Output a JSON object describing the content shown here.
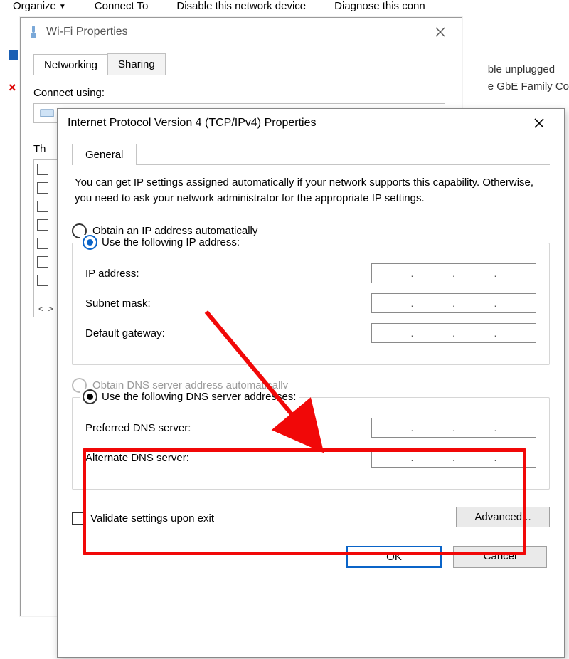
{
  "bg_toolbar": {
    "organize": "Organize",
    "connect": "Connect To",
    "disable": "Disable this network device",
    "diagnose": "Diagnose this conn"
  },
  "bg_right": {
    "line1": "ble unplugged",
    "line2": "e GbE Family Co"
  },
  "wifi": {
    "title": "Wi-Fi Properties",
    "tab_networking": "Networking",
    "tab_sharing": "Sharing",
    "connect_using": "Connect using:",
    "items_label": "Th"
  },
  "ipv4": {
    "title": "Internet Protocol Version 4 (TCP/IPv4) Properties",
    "tab_general": "General",
    "intro": "You can get IP settings assigned automatically if your network supports this capability. Otherwise, you need to ask your network administrator for the appropriate IP settings.",
    "obtain_ip_auto": "Obtain an IP address automatically",
    "use_ip": "Use the following IP address:",
    "ip_address": "IP address:",
    "subnet": "Subnet mask:",
    "gateway": "Default gateway:",
    "obtain_dns_auto": "Obtain DNS server address automatically",
    "use_dns": "Use the following DNS server addresses:",
    "pref_dns": "Preferred DNS server:",
    "alt_dns": "Alternate DNS server:",
    "validate": "Validate settings upon exit",
    "advanced": "Advanced...",
    "ok": "OK",
    "cancel": "Cancel"
  }
}
